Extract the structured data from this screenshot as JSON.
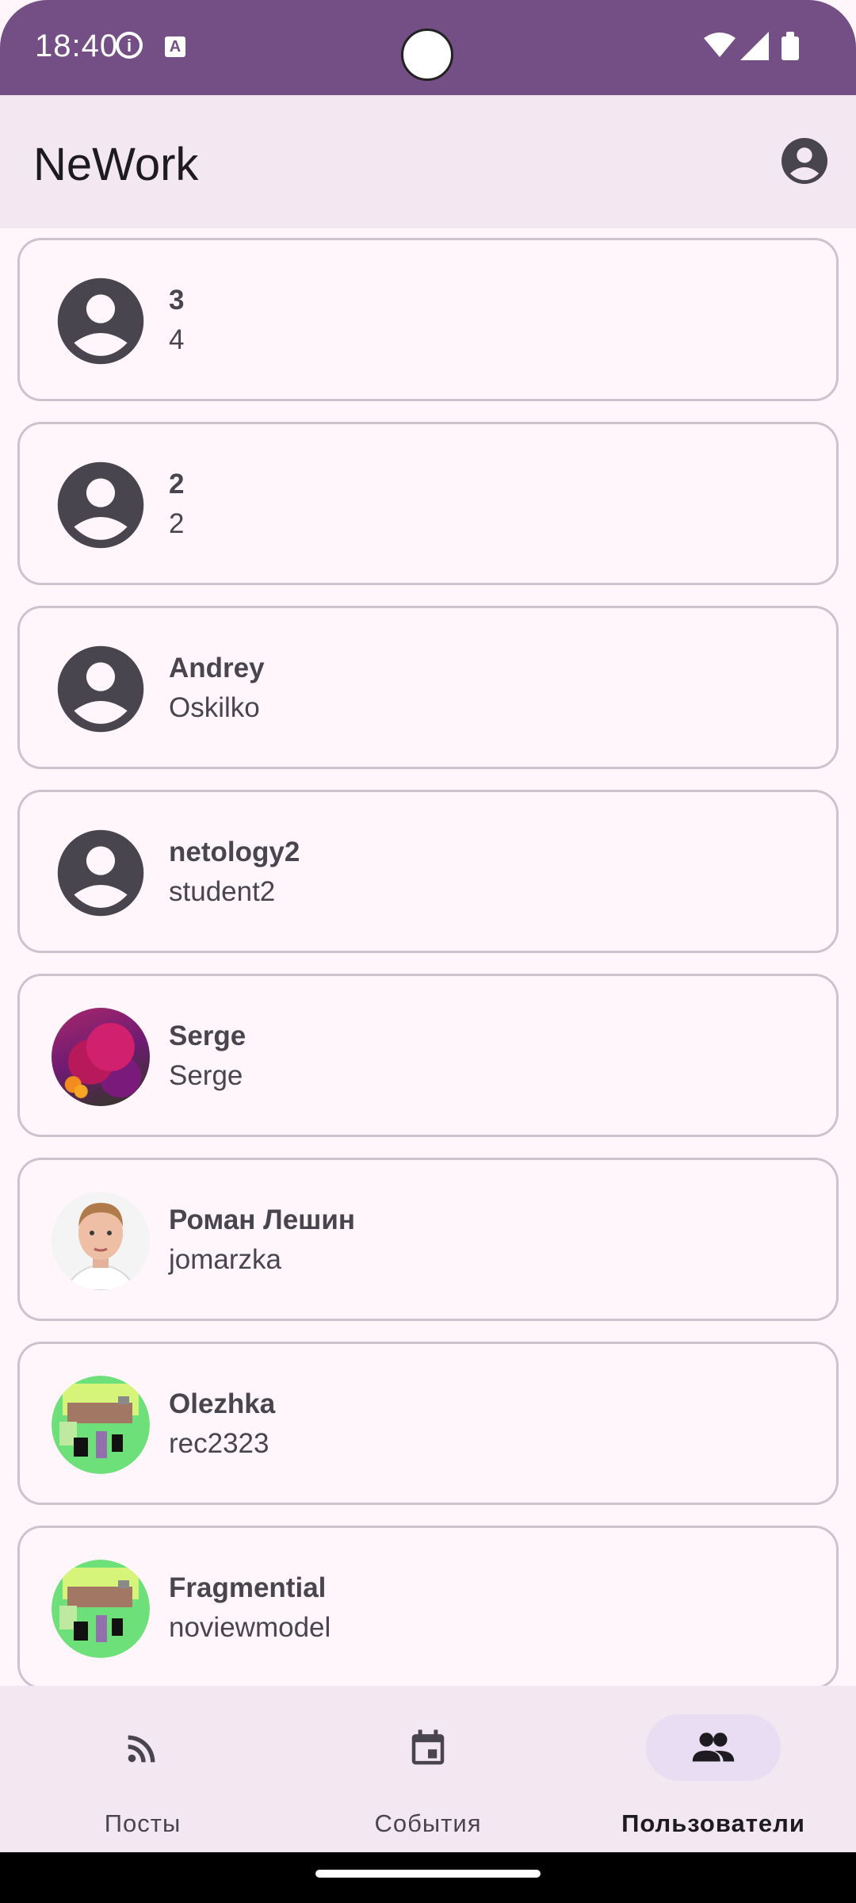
{
  "status_bar": {
    "time": "18:40",
    "info_glyph": "i",
    "a_glyph": "A"
  },
  "app_bar": {
    "title": "NeWork",
    "account_icon": "account-circle-icon"
  },
  "users": [
    {
      "name": "3",
      "login": "4",
      "avatar": "default"
    },
    {
      "name": "2",
      "login": "2",
      "avatar": "default"
    },
    {
      "name": "Andrey",
      "login": "Oskilko",
      "avatar": "default"
    },
    {
      "name": "netology2",
      "login": "student2",
      "avatar": "default"
    },
    {
      "name": "Serge",
      "login": "Serge",
      "avatar": "flowers-photo"
    },
    {
      "name": "Роман Лешин",
      "login": "jomarzka",
      "avatar": "portrait-photo"
    },
    {
      "name": "Olezhka",
      "login": "rec2323",
      "avatar": "pixel-house"
    },
    {
      "name": "Fragmential",
      "login": "noviewmodel",
      "avatar": "pixel-house"
    }
  ],
  "bottom_nav": {
    "items": [
      {
        "label": "Посты",
        "icon": "rss-feed-icon",
        "active": false
      },
      {
        "label": "События",
        "icon": "calendar-event-icon",
        "active": false
      },
      {
        "label": "Пользователи",
        "icon": "people-icon",
        "active": true
      }
    ]
  },
  "colors": {
    "status_bar": "#744f85",
    "app_bar": "#f3e8f1",
    "background": "#fff6fb",
    "card_border": "#cbc4cf",
    "active_indicator": "#e9ddf3",
    "text_secondary": "#49454f"
  }
}
